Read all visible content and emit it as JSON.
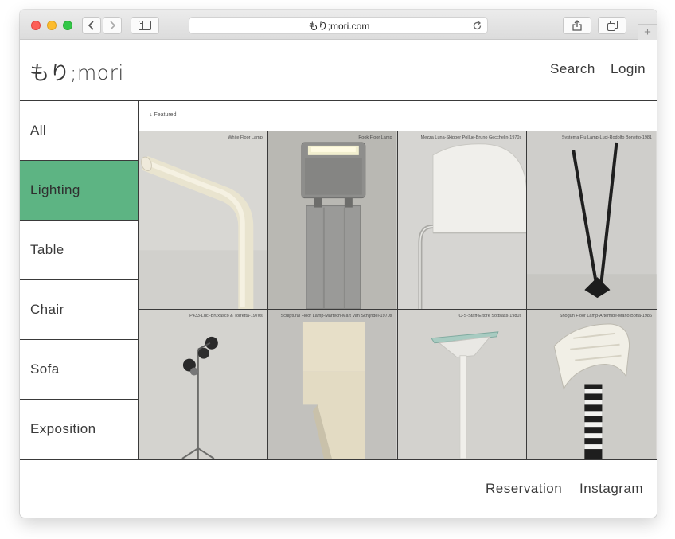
{
  "browser": {
    "url": "もり;mori.com",
    "new_tab_glyph": "+"
  },
  "header": {
    "logo": "もり;mori",
    "nav": [
      {
        "label": "Search"
      },
      {
        "label": "Login"
      }
    ]
  },
  "sidebar": {
    "categories": [
      {
        "label": "All",
        "active": false
      },
      {
        "label": "Lighting",
        "active": true
      },
      {
        "label": "Table",
        "active": false
      },
      {
        "label": "Chair",
        "active": false
      },
      {
        "label": "Sofa",
        "active": false
      },
      {
        "label": "Exposition",
        "active": false
      }
    ],
    "active_color": "#5db483"
  },
  "main": {
    "featured_label": "↓ Featured",
    "products": [
      {
        "caption": "White Floor Lamp"
      },
      {
        "caption": "Rook Floor Lamp"
      },
      {
        "caption": "Mezza Luna-Skipper Pollue-Bruno Gecchelin-1970s"
      },
      {
        "caption": "Systema Flu Lamp-Luci-Rodolfo Bonetto-1981"
      },
      {
        "caption": "P433-Luci-Bruxasco & Torretta-1970s"
      },
      {
        "caption": "Sculptural Floor Lamp-Martech-Mart Van Schijndel-1970s"
      },
      {
        "caption": "IO-S-Staff-Ettore Sottsass-1980s"
      },
      {
        "caption": "Shogun Floor Lamp-Artemide-Mario Botta-1986"
      }
    ]
  },
  "footer": {
    "links": [
      {
        "label": "Reservation"
      },
      {
        "label": "Instagram"
      }
    ]
  }
}
